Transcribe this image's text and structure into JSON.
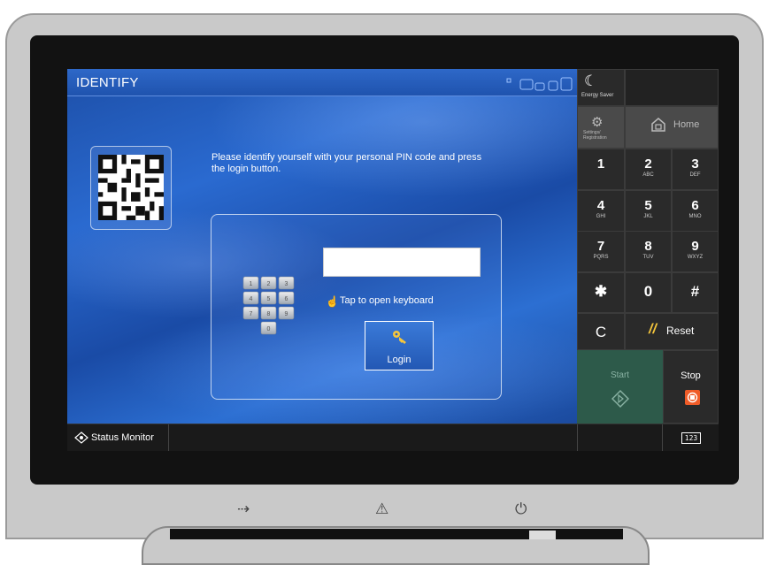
{
  "screen": {
    "title": "IDENTIFY",
    "instruction": "Please identify yourself with your personal PIN code and press the login button.",
    "pin_input": {
      "value": "",
      "placeholder": ""
    },
    "tap_keyboard_label": "Tap to open keyboard",
    "login_label": "Login",
    "keypad_icon_digits": [
      "1",
      "2",
      "3",
      "4",
      "5",
      "6",
      "7",
      "8",
      "9",
      "0"
    ],
    "qr_icon": "qr-code-icon"
  },
  "status_bar": {
    "status_monitor_label": "Status Monitor",
    "keyboard_icon_text": "123"
  },
  "side_panel": {
    "energy_saver_label": "Energy Saver",
    "settings_label": "Settings/ Registration",
    "home_label": "Home",
    "keys": [
      {
        "digit": "1",
        "letters": ""
      },
      {
        "digit": "2",
        "letters": "ABC"
      },
      {
        "digit": "3",
        "letters": "DEF"
      },
      {
        "digit": "4",
        "letters": "GHI"
      },
      {
        "digit": "5",
        "letters": "JKL"
      },
      {
        "digit": "6",
        "letters": "MNO"
      },
      {
        "digit": "7",
        "letters": "PQRS"
      },
      {
        "digit": "8",
        "letters": "TUV"
      },
      {
        "digit": "9",
        "letters": "WXYZ"
      }
    ],
    "star_label": "✱",
    "zero_label": "0",
    "hash_label": "#",
    "clear_label": "C",
    "reset_label": "Reset",
    "start_label": "Start",
    "stop_label": "Stop"
  },
  "colors": {
    "title_bar": "#1f53ae",
    "start_bg": "#2d5a4a",
    "stop_icon": "#f05c28",
    "reset_accent": "#f5c63c"
  }
}
